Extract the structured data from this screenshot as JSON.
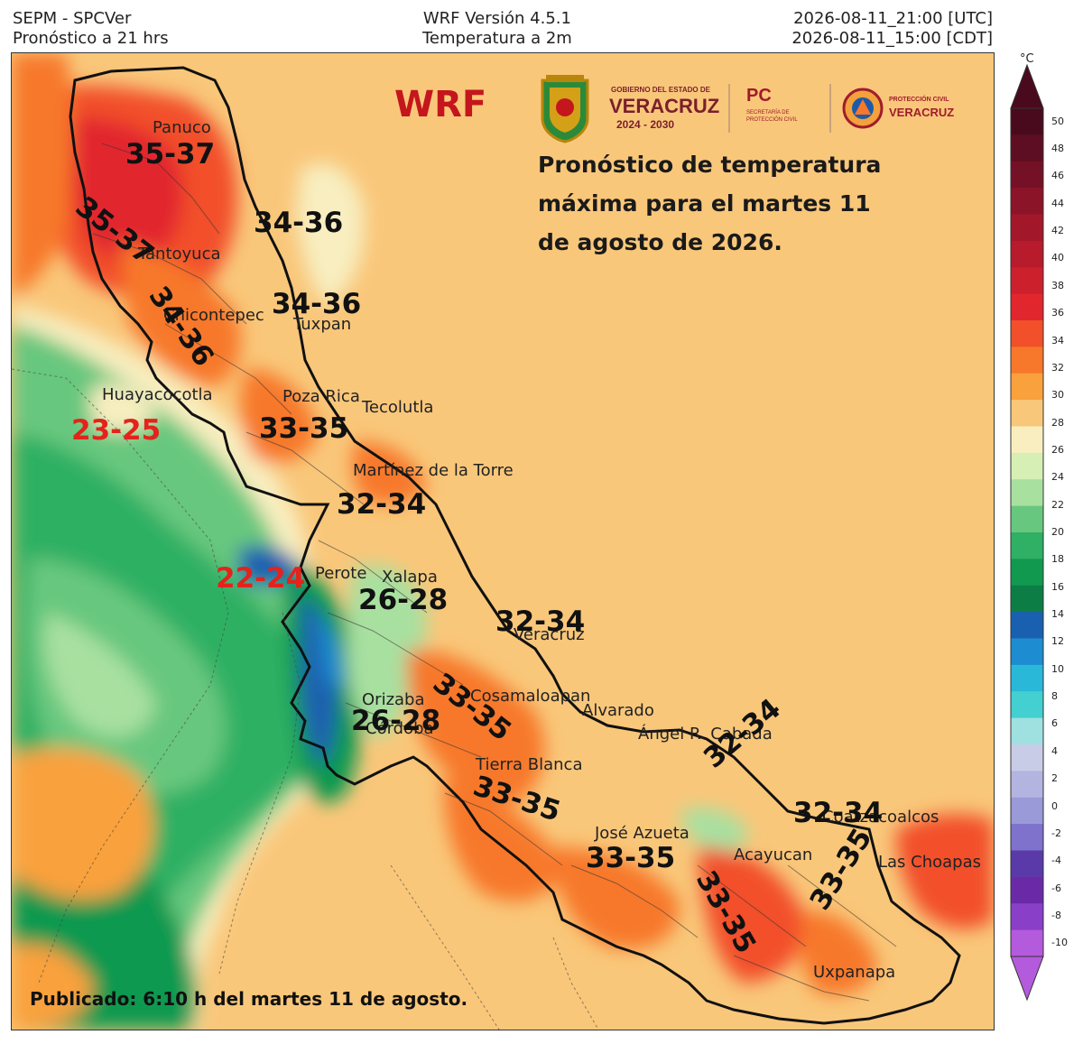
{
  "header": {
    "left_line1": "SEPM - SPCVer",
    "left_line2": "Pronóstico a 21 hrs",
    "center_line1": "WRF Versión 4.5.1",
    "center_line2": "Temperatura a 2m",
    "right_line1": "2026-08-11_21:00 [UTC]",
    "right_line2": "2026-08-11_15:00 [CDT]"
  },
  "wrf_label": "WRF",
  "logos": {
    "gov_line1": "GOBIERNO DEL ESTADO DE",
    "gov_line2": "VERACRUZ",
    "gov_line3": "2024 - 2030",
    "pc_label": "PC",
    "pc_sub": "SECRETARÍA DE PROTECCIÓN CIVIL",
    "pcv_line1": "PROTECCIÓN CIVIL",
    "pcv_line2": "VERACRUZ"
  },
  "headline": {
    "line1": "Pronóstico de temperatura",
    "line2": "máxima para el martes 11",
    "line3": "de agosto de 2026."
  },
  "published": "Publicado: 6:10 h del martes 11 de agosto.",
  "cities": {
    "panuco": "Panuco",
    "tantoyuca": "Tantoyuca",
    "chicontepec": "Chicontepec",
    "tuxpan": "Tuxpan",
    "huayacocotla": "Huayacocotla",
    "poza_rica": "Poza Rica",
    "tecolutla": "Tecolutla",
    "martinez": "Martínez de la Torre",
    "perote": "Perote",
    "xalapa": "Xalapa",
    "veracruz": "Veracruz",
    "orizaba": "Orizaba",
    "cordoba": "Córdoba",
    "cosamaloapan": "Cosamaloapan",
    "alvarado": "Alvarado",
    "angel_cabada": "Ángel R. Cabada",
    "tierra_blanca": "Tierra Blanca",
    "jose_azueta": "José Azueta",
    "acayucan": "Acayucan",
    "coatzacoalcos": "Coatzacoalcos",
    "las_choapas": "Las Choapas",
    "uxpanapa": "Uxpanapa"
  },
  "ranges": {
    "r1": "35-37",
    "r2": "35-37",
    "r3": "34-36",
    "r4": "34-36",
    "r5": "34-36",
    "r6": "23-25",
    "r7": "33-35",
    "r8": "32-34",
    "r9": "22-24",
    "r10": "26-28",
    "r11": "32-34",
    "r12": "33-35",
    "r13": "26-28",
    "r14": "32-34",
    "r15": "33-35",
    "r16": "32-34",
    "r17": "33-35",
    "r18": "33-35",
    "r19": "33-35"
  },
  "colorbar": {
    "unit": "°C",
    "ticks": [
      50,
      48,
      46,
      44,
      42,
      40,
      38,
      36,
      34,
      32,
      30,
      28,
      26,
      24,
      22,
      20,
      18,
      16,
      14,
      12,
      10,
      8,
      6,
      4,
      2,
      0,
      -2,
      -4,
      -6,
      -8,
      -10
    ],
    "colors": [
      "#4a0a1e",
      "#5e0e22",
      "#751126",
      "#8c1428",
      "#a3172a",
      "#b81b2c",
      "#cc202d",
      "#e2262e",
      "#f2502a",
      "#f7782a",
      "#f9a13c",
      "#f9c77a",
      "#f8eec0",
      "#d6efb4",
      "#a8e0a0",
      "#68c77e",
      "#2fb064",
      "#119950",
      "#0d7d46",
      "#1a60b0",
      "#1e8cd0",
      "#2ab8d8",
      "#44cfd0",
      "#9fe0e0",
      "#c8cce6",
      "#b4b4e0",
      "#9a9ad8",
      "#7e72cc",
      "#5a3aa8",
      "#6a2aa8",
      "#8a3fc8",
      "#b45adc"
    ]
  }
}
